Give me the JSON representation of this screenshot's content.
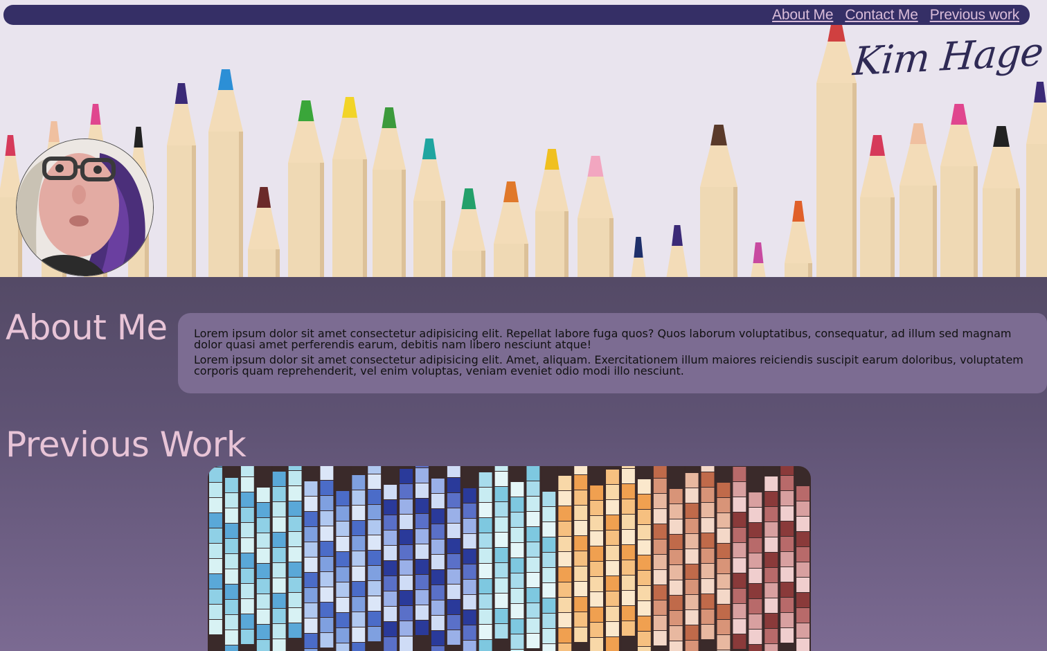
{
  "nav": {
    "links": [
      "About Me",
      "Contact Me",
      "Previous work"
    ]
  },
  "brand": {
    "name": "Kim Hage"
  },
  "about": {
    "heading": "About Me",
    "paragraphs": [
      "Lorem ipsum dolor sit amet consectetur adipisicing elit. Repellat labore fuga quos? Quos laborum voluptatibus, consequatur, ad illum sed magnam dolor quasi amet perferendis earum, debitis nam libero nesciunt atque!",
      "Lorem ipsum dolor sit amet consectetur adipisicing elit. Amet, aliquam. Exercitationem illum maiores reiciendis suscipit earum doloribus, voluptatem corporis quam reprehenderit, vel enim voluptas, veniam eveniet odio modi illo nesciunt."
    ]
  },
  "work": {
    "heading": "Previous Work"
  },
  "colors": {
    "nav_bg": "#352f66",
    "nav_link": "#d9bcd9",
    "heading": "#e8c4d7",
    "about_box": "#7c6c92",
    "brand": "#2f2a55"
  }
}
